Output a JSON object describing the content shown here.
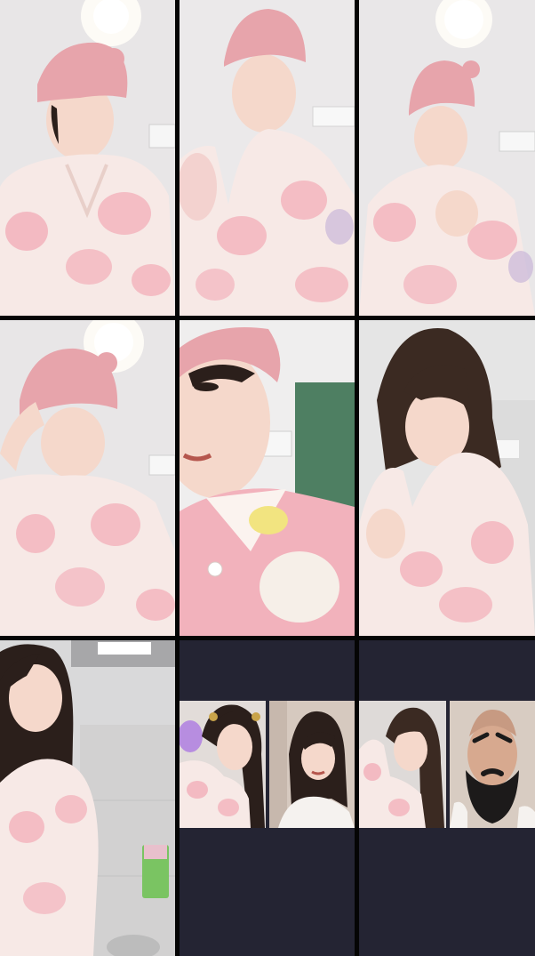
{
  "layout": {
    "columns": 3,
    "rows": 3
  },
  "colors": {
    "background": "#050505",
    "wall": "#e6e3e4",
    "pajama_base": "#f7e9e6",
    "pajama_pink": "#f2aab5",
    "towel_pink": "#e7a4ab",
    "skin": "#f5d8cb",
    "hair_dark": "#2b1f1b",
    "hair_brown": "#3b2a22",
    "dark_tile": "#242433",
    "curtain_green": "#4e7f62",
    "light_glow": "#fffdf7"
  },
  "tiles": [
    {
      "name": "video-tile-1",
      "subject": "towel-wrap-smile"
    },
    {
      "name": "video-tile-2",
      "subject": "towel-wrap-talking"
    },
    {
      "name": "video-tile-3",
      "subject": "towel-wrap-hands"
    },
    {
      "name": "video-tile-4",
      "subject": "towel-wrap-hand-on-head"
    },
    {
      "name": "video-tile-5",
      "subject": "close-up-face"
    },
    {
      "name": "video-tile-6",
      "subject": "hair-down"
    },
    {
      "name": "video-tile-7",
      "subject": "bathroom-selfie"
    },
    {
      "name": "video-tile-8",
      "subject": "split-call"
    },
    {
      "name": "video-tile-9",
      "subject": "split-call-beard-filter"
    }
  ]
}
